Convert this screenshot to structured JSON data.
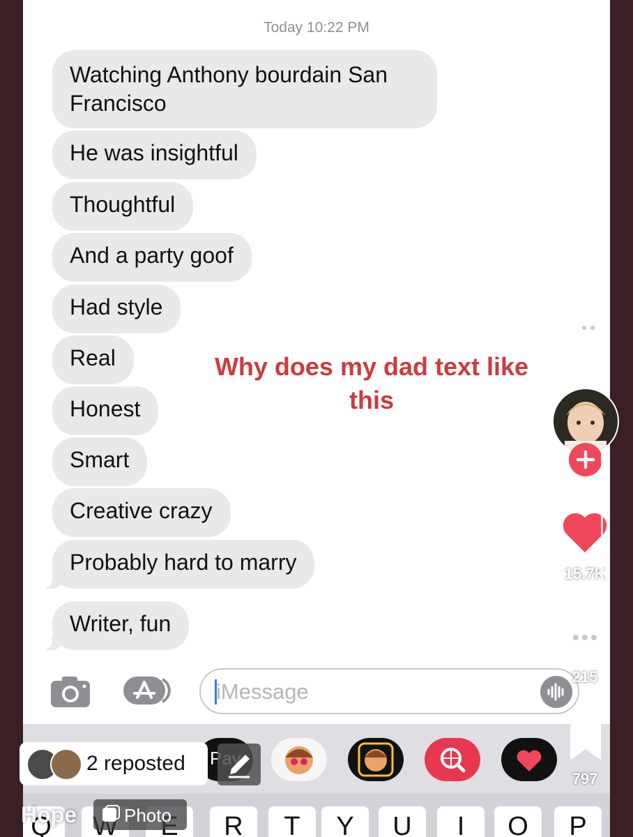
{
  "conversation": {
    "timestamp": "Today 10:22 PM",
    "messages": [
      "Watching Anthony bourdain San Francisco",
      "He was insightful",
      "Thoughtful",
      "And a party goof",
      "Had style",
      "Real",
      "Honest",
      "Smart",
      "Creative crazy",
      "Probably hard to marry",
      "Writer, fun"
    ]
  },
  "compose": {
    "placeholder": "iMessage"
  },
  "keyboard": {
    "keys": [
      "Q",
      "W",
      "E",
      "R",
      "T",
      "Y",
      "U",
      "I",
      "O",
      "P"
    ]
  },
  "tray": {
    "apple_pay_label": "Pay"
  },
  "overlay": {
    "caption": "Why does my dad text like this"
  },
  "tiktok": {
    "likes": "15.7K",
    "comments": "215",
    "bookmarks": "797",
    "repost_text": "2 reposted",
    "author": "Hope",
    "content_type": "Photo"
  },
  "colors": {
    "bubble_gray": "#e9e9eb",
    "caption_red": "#cc3b3e",
    "like_red": "#f0475b",
    "frame": "#3a1f24"
  }
}
